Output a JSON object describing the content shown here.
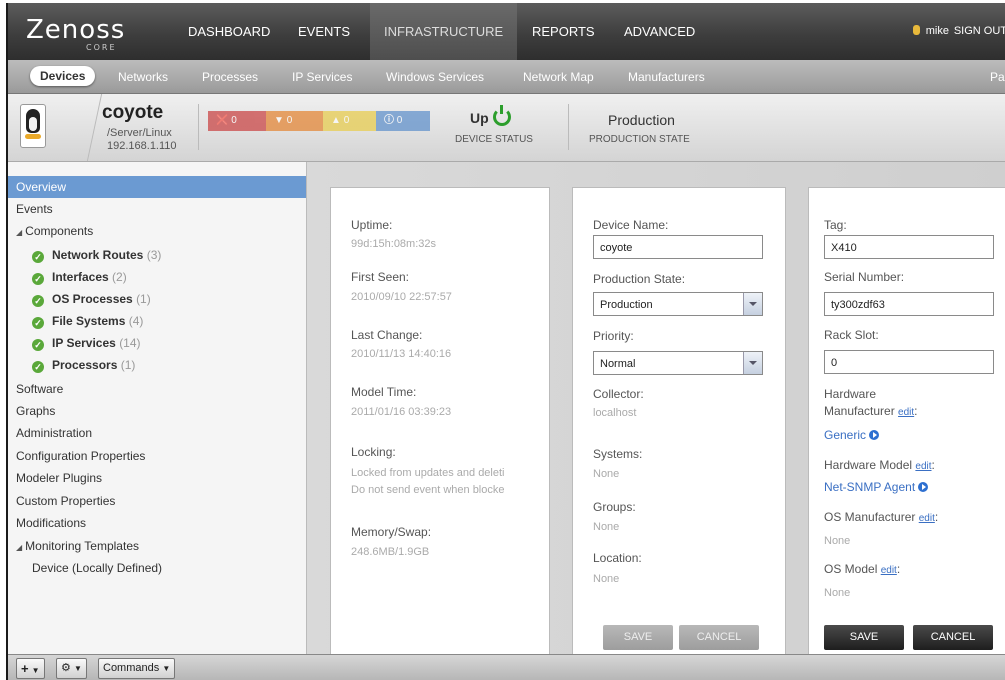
{
  "brand": {
    "logo": "Zenoss",
    "edition": "CORE"
  },
  "topnav": {
    "items": [
      "DASHBOARD",
      "EVENTS",
      "INFRASTRUCTURE",
      "REPORTS",
      "ADVANCED"
    ],
    "user": "mike",
    "signout": "SIGN OUT"
  },
  "subnav": {
    "items": [
      "Devices",
      "Networks",
      "Processes",
      "IP Services",
      "Windows Services",
      "Network Map",
      "Manufacturers"
    ],
    "right": "Pa"
  },
  "device": {
    "name": "coyote",
    "class": "/Server/Linux",
    "ip": "192.168.1.110",
    "events": [
      "0",
      "0",
      "0",
      "0"
    ],
    "status_value": "Up",
    "status_label": "DEVICE STATUS",
    "prod_value": "Production",
    "prod_label": "PRODUCTION STATE",
    "colors": {
      "critical": "#c63030",
      "error": "#e47a1f",
      "warning": "#e8c93b",
      "info": "#4f86c8"
    }
  },
  "sidebar": {
    "items": [
      "Overview",
      "Events",
      "Components"
    ],
    "components": [
      {
        "label": "Network Routes",
        "count": "(3)"
      },
      {
        "label": "Interfaces",
        "count": "(2)"
      },
      {
        "label": "OS Processes",
        "count": "(1)"
      },
      {
        "label": "File Systems",
        "count": "(4)"
      },
      {
        "label": "IP Services",
        "count": "(14)"
      },
      {
        "label": "Processors",
        "count": "(1)"
      }
    ],
    "more": [
      "Software",
      "Graphs",
      "Administration",
      "Configuration Properties",
      "Modeler Plugins",
      "Custom Properties",
      "Modifications",
      "Monitoring Templates"
    ],
    "template_child": "Device (Locally Defined)"
  },
  "overview": {
    "uptime_label": "Uptime:",
    "uptime": "99d:15h:08m:32s",
    "first_seen_label": "First Seen:",
    "first_seen": "2010/09/10 22:57:57",
    "last_change_label": "Last Change:",
    "last_change": "2010/11/13 14:40:16",
    "model_time_label": "Model Time:",
    "model_time": "2011/01/16 03:39:23",
    "locking_label": "Locking:",
    "locking_1": "Locked from updates and deleti",
    "locking_2": "Do not send event when blocke",
    "memory_label": "Memory/Swap:",
    "memory": "248.6MB/1.9GB"
  },
  "form1": {
    "device_name_label": "Device Name:",
    "device_name": "coyote",
    "prod_state_label": "Production State:",
    "prod_state": "Production",
    "priority_label": "Priority:",
    "priority": "Normal",
    "collector_label": "Collector:",
    "collector": "localhost",
    "systems_label": "Systems:",
    "systems": "None",
    "groups_label": "Groups:",
    "groups": "None",
    "location_label": "Location:",
    "location": "None",
    "save": "SAVE",
    "cancel": "CANCEL"
  },
  "form2": {
    "tag_label": "Tag:",
    "tag": "X410",
    "serial_label": "Serial Number:",
    "serial": "ty300zdf63",
    "rack_label": "Rack Slot:",
    "rack": "0",
    "hw_mfr_label_1": "Hardware",
    "hw_mfr_label_2": "Manufacturer",
    "hw_mfr": "Generic",
    "hw_model_label": "Hardware Model",
    "hw_model": "Net-SNMP Agent",
    "os_mfr_label": "OS Manufacturer",
    "os_mfr": "None",
    "os_model_label": "OS Model",
    "os_model": "None",
    "edit": "edit",
    "colon": ":",
    "save": "SAVE",
    "cancel": "CANCEL"
  },
  "toolbar": {
    "add": "+",
    "gear": "⚙",
    "commands": "Commands"
  }
}
